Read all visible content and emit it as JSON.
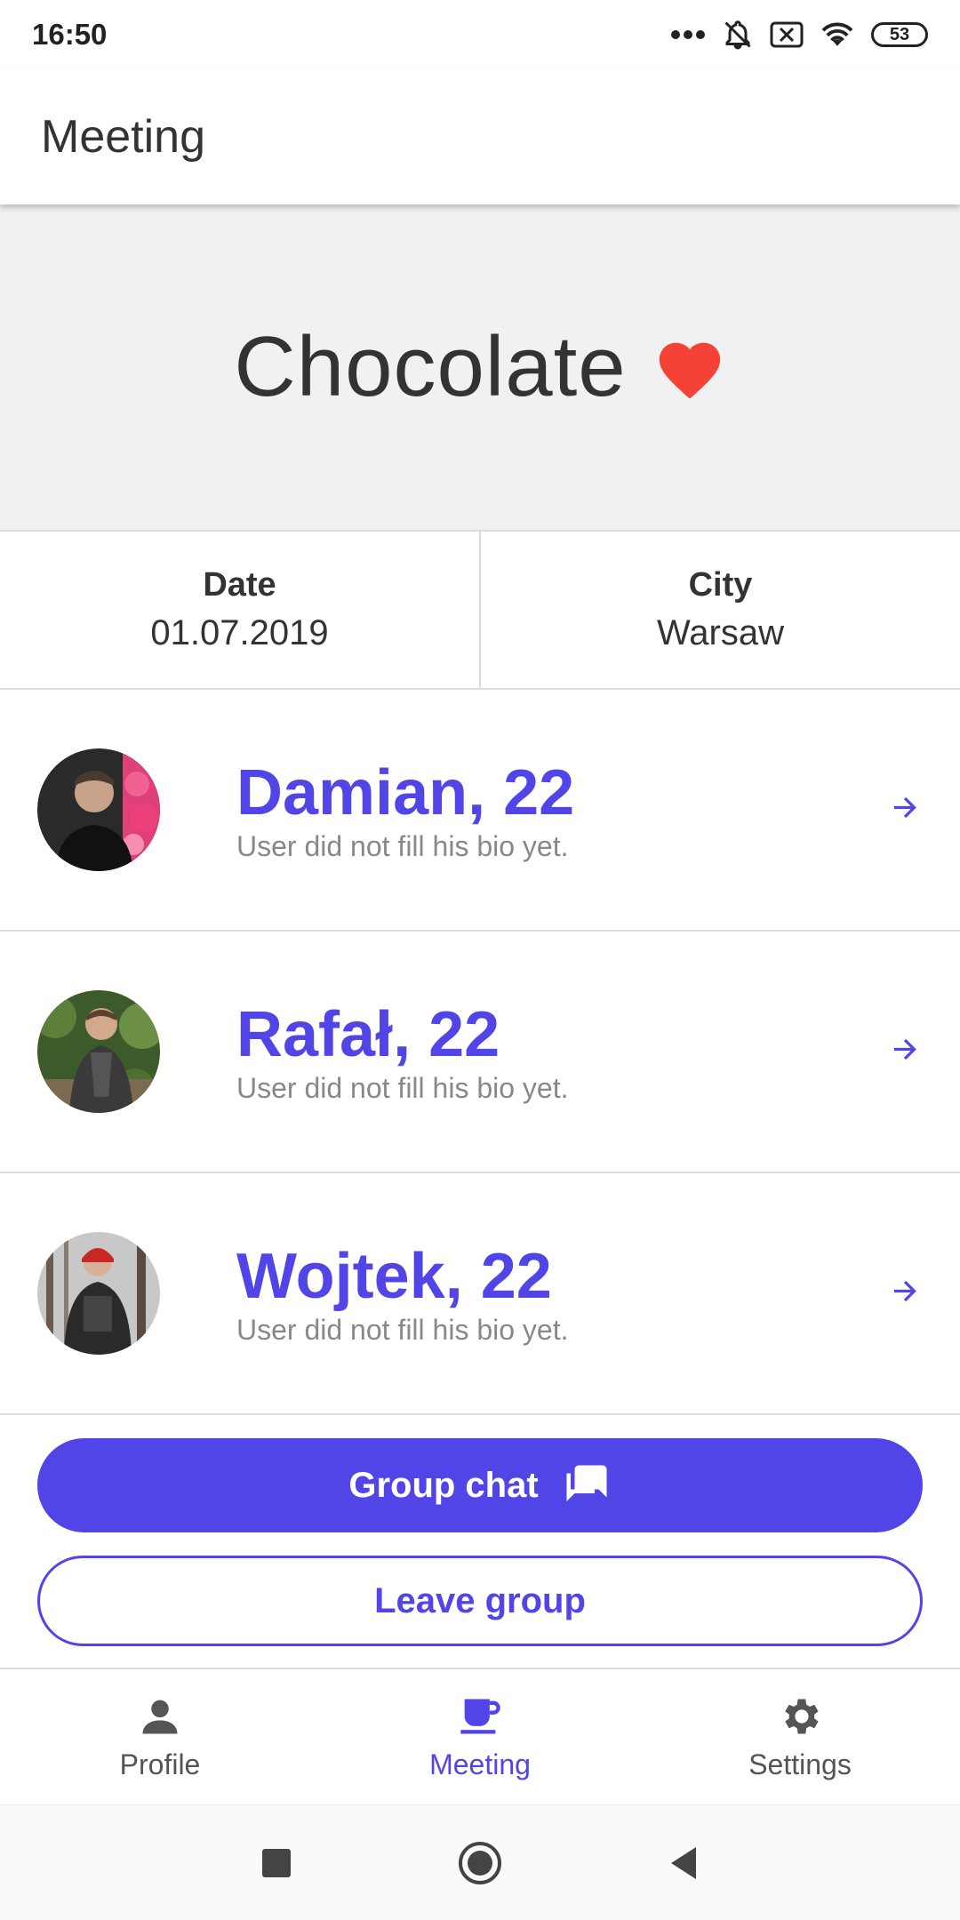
{
  "status_bar": {
    "time": "16:50",
    "battery": "53"
  },
  "app_bar": {
    "title": "Meeting"
  },
  "hero": {
    "title": "Chocolate",
    "heart_color": "#f44336"
  },
  "info": {
    "date_label": "Date",
    "date_value": "01.07.2019",
    "city_label": "City",
    "city_value": "Warsaw"
  },
  "members": [
    {
      "name": "Damian, 22",
      "bio": "User did not fill his bio yet."
    },
    {
      "name": "Rafał, 22",
      "bio": "User did not fill his bio yet."
    },
    {
      "name": "Wojtek, 22",
      "bio": "User did not fill his bio yet."
    }
  ],
  "actions": {
    "group_chat_label": "Group chat",
    "leave_group_label": "Leave group"
  },
  "bottom_nav": {
    "items": [
      {
        "label": "Profile",
        "icon": "person-icon"
      },
      {
        "label": "Meeting",
        "icon": "coffee-icon",
        "active": true
      },
      {
        "label": "Settings",
        "icon": "gear-icon"
      }
    ]
  },
  "colors": {
    "accent": "#5245e8",
    "heart": "#f44336",
    "hero_bg": "#f1f1f4"
  }
}
